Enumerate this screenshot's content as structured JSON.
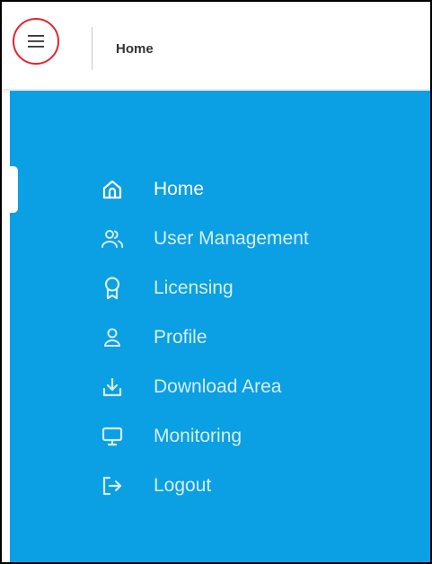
{
  "header": {
    "title": "Home",
    "menu_icon": "hamburger-icon"
  },
  "sidebar": {
    "background": "#0b9fe3",
    "active_item": "Home",
    "items": [
      {
        "label": "Home",
        "icon": "home-icon"
      },
      {
        "label": "User Management",
        "icon": "users-icon"
      },
      {
        "label": "Licensing",
        "icon": "award-icon"
      },
      {
        "label": "Profile",
        "icon": "user-icon"
      },
      {
        "label": "Download Area",
        "icon": "download-icon"
      },
      {
        "label": "Monitoring",
        "icon": "monitor-icon"
      },
      {
        "label": "Logout",
        "icon": "logout-icon"
      }
    ]
  },
  "highlight_color": "#e0262d"
}
